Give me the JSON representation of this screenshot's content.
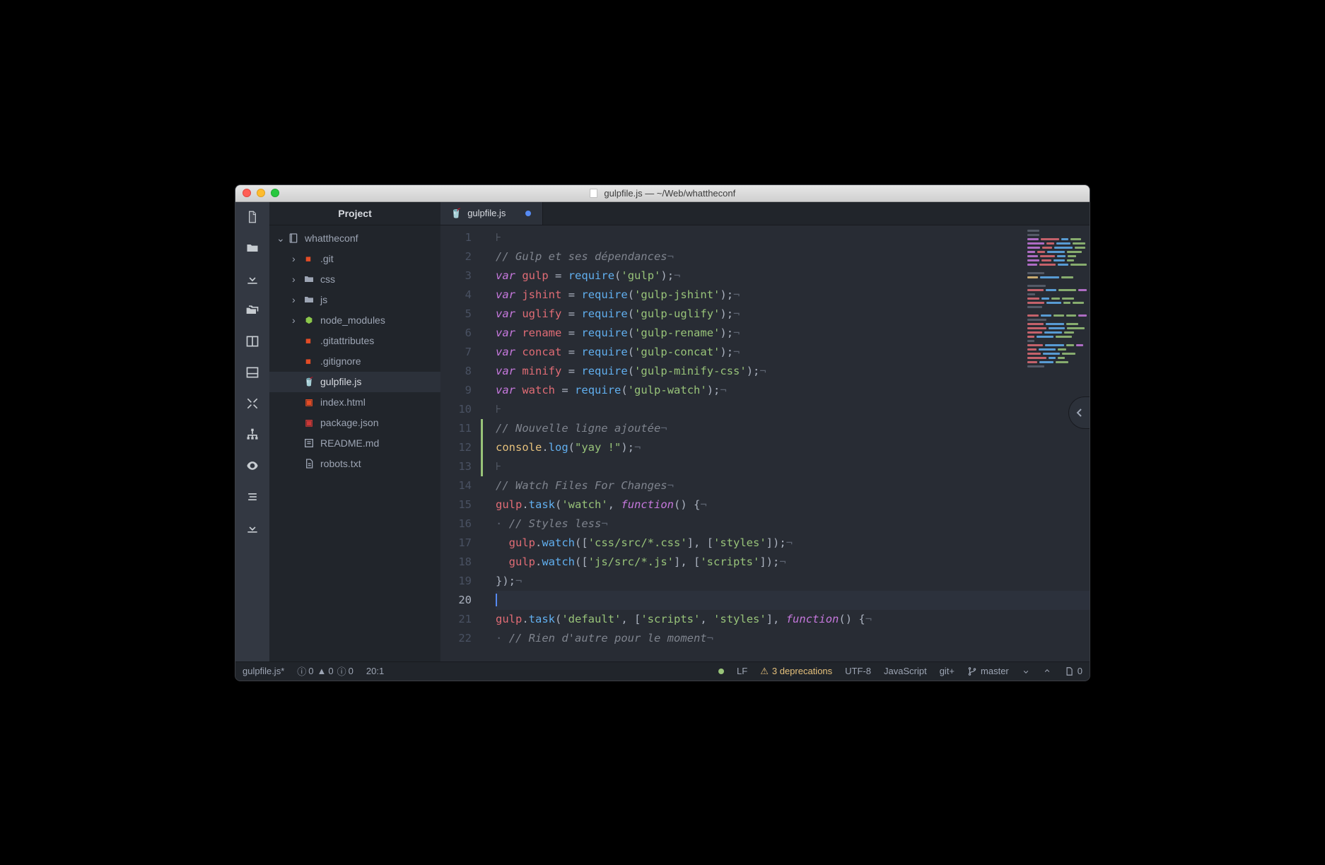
{
  "window": {
    "title": "gulpfile.js — ~/Web/whattheconf"
  },
  "sidebar": {
    "header": "Project",
    "tree": [
      {
        "depth": 0,
        "chevron": "⌄",
        "icon": "repo",
        "label": "whattheconf"
      },
      {
        "depth": 1,
        "chevron": "›",
        "icon": "git",
        "label": ".git"
      },
      {
        "depth": 1,
        "chevron": "›",
        "icon": "folder",
        "label": "css"
      },
      {
        "depth": 1,
        "chevron": "›",
        "icon": "folder",
        "label": "js"
      },
      {
        "depth": 1,
        "chevron": "›",
        "icon": "node",
        "label": "node_modules"
      },
      {
        "depth": 1,
        "chevron": "",
        "icon": "git",
        "label": ".gitattributes"
      },
      {
        "depth": 1,
        "chevron": "",
        "icon": "git",
        "label": ".gitignore"
      },
      {
        "depth": 1,
        "chevron": "",
        "icon": "gulp",
        "label": "gulpfile.js",
        "selected": true
      },
      {
        "depth": 1,
        "chevron": "",
        "icon": "html",
        "label": "index.html"
      },
      {
        "depth": 1,
        "chevron": "",
        "icon": "npm",
        "label": "package.json"
      },
      {
        "depth": 1,
        "chevron": "",
        "icon": "md",
        "label": "README.md"
      },
      {
        "depth": 1,
        "chevron": "",
        "icon": "txt",
        "label": "robots.txt"
      }
    ]
  },
  "tab": {
    "icon": "gulp",
    "label": "gulpfile.js",
    "modified": true
  },
  "editor": {
    "current_line": 20,
    "git_added_ranges": [
      [
        11,
        13
      ]
    ],
    "lines": [
      {
        "n": 1,
        "html": "<span class='c-inv'>⊦</span>"
      },
      {
        "n": 2,
        "html": "<span class='c-cmt'>// Gulp et ses dépendances</span><span class='c-inv'>¬</span>"
      },
      {
        "n": 3,
        "html": "<span class='c-kw'>var</span> <span class='c-var'>gulp</span> <span class='c-op'>=</span> <span class='c-fn'>require</span><span class='c-punc'>(</span><span class='c-str'>'gulp'</span><span class='c-punc'>);</span><span class='c-inv'>¬</span>"
      },
      {
        "n": 4,
        "html": "<span class='c-kw'>var</span> <span class='c-var'>jshint</span> <span class='c-op'>=</span> <span class='c-fn'>require</span><span class='c-punc'>(</span><span class='c-str'>'gulp-jshint'</span><span class='c-punc'>);</span><span class='c-inv'>¬</span>"
      },
      {
        "n": 5,
        "html": "<span class='c-kw'>var</span> <span class='c-var'>uglify</span> <span class='c-op'>=</span> <span class='c-fn'>require</span><span class='c-punc'>(</span><span class='c-str'>'gulp-uglify'</span><span class='c-punc'>);</span><span class='c-inv'>¬</span>"
      },
      {
        "n": 6,
        "html": "<span class='c-kw'>var</span> <span class='c-var'>rename</span> <span class='c-op'>=</span> <span class='c-fn'>require</span><span class='c-punc'>(</span><span class='c-str'>'gulp-rename'</span><span class='c-punc'>);</span><span class='c-inv'>¬</span>"
      },
      {
        "n": 7,
        "html": "<span class='c-kw'>var</span> <span class='c-var'>concat</span> <span class='c-op'>=</span> <span class='c-fn'>require</span><span class='c-punc'>(</span><span class='c-str'>'gulp-concat'</span><span class='c-punc'>);</span><span class='c-inv'>¬</span>"
      },
      {
        "n": 8,
        "html": "<span class='c-kw'>var</span> <span class='c-var'>minify</span> <span class='c-op'>=</span> <span class='c-fn'>require</span><span class='c-punc'>(</span><span class='c-str'>'gulp-minify-css'</span><span class='c-punc'>);</span><span class='c-inv'>¬</span>"
      },
      {
        "n": 9,
        "html": "<span class='c-kw'>var</span> <span class='c-var'>watch</span> <span class='c-op'>=</span> <span class='c-fn'>require</span><span class='c-punc'>(</span><span class='c-str'>'gulp-watch'</span><span class='c-punc'>);</span><span class='c-inv'>¬</span>"
      },
      {
        "n": 10,
        "html": "<span class='c-inv'>⊦</span>"
      },
      {
        "n": 11,
        "html": "<span class='c-cmt'>// Nouvelle ligne ajoutée</span><span class='c-inv'>¬</span>"
      },
      {
        "n": 12,
        "html": "<span class='c-obj'>console</span><span class='c-punc'>.</span><span class='c-fn'>log</span><span class='c-punc'>(</span><span class='c-str'>\"yay !\"</span><span class='c-punc'>);</span><span class='c-inv'>¬</span>"
      },
      {
        "n": 13,
        "html": "<span class='c-inv'>⊦</span>"
      },
      {
        "n": 14,
        "html": "<span class='c-cmt'>// Watch Files For Changes</span><span class='c-inv'>¬</span>"
      },
      {
        "n": 15,
        "html": "<span class='c-var'>gulp</span><span class='c-punc'>.</span><span class='c-fn'>task</span><span class='c-punc'>(</span><span class='c-str'>'watch'</span><span class='c-punc'>,</span> <span class='c-kw'>function</span><span class='c-punc'>() {</span><span class='c-inv'>¬</span>"
      },
      {
        "n": 16,
        "html": "<span class='c-inv'>·</span> <span class='c-cmt'>// Styles less</span><span class='c-inv'>¬</span>"
      },
      {
        "n": 17,
        "html": "  <span class='c-var'>gulp</span><span class='c-punc'>.</span><span class='c-fn'>watch</span><span class='c-punc'>([</span><span class='c-str'>'css/src/*.css'</span><span class='c-punc'>], [</span><span class='c-str'>'styles'</span><span class='c-punc'>]);</span><span class='c-inv'>¬</span>"
      },
      {
        "n": 18,
        "html": "  <span class='c-var'>gulp</span><span class='c-punc'>.</span><span class='c-fn'>watch</span><span class='c-punc'>([</span><span class='c-str'>'js/src/*.js'</span><span class='c-punc'>], [</span><span class='c-str'>'scripts'</span><span class='c-punc'>]);</span><span class='c-inv'>¬</span>"
      },
      {
        "n": 19,
        "html": "<span class='c-punc'>});</span><span class='c-inv'>¬</span>"
      },
      {
        "n": 20,
        "html": "<span class='c-inv' style='border-left:2px solid #568af2;'>&nbsp;</span>"
      },
      {
        "n": 21,
        "html": "<span class='c-var'>gulp</span><span class='c-punc'>.</span><span class='c-fn'>task</span><span class='c-punc'>(</span><span class='c-str'>'default'</span><span class='c-punc'>, [</span><span class='c-str'>'scripts'</span><span class='c-punc'>,</span> <span class='c-str'>'styles'</span><span class='c-punc'>],</span> <span class='c-kw'>function</span><span class='c-punc'>() {</span><span class='c-inv'>¬</span>"
      },
      {
        "n": 22,
        "html": "<span class='c-inv'>·</span> <span class='c-cmt'>// Rien d'autre pour le moment</span><span class='c-inv'>¬</span>"
      }
    ]
  },
  "status": {
    "filename": "gulpfile.js*",
    "diag_errors": "0",
    "diag_warnings": "0",
    "diag_info": "0",
    "cursor": "20:1",
    "line_ending": "LF",
    "deprecations": "3 deprecations",
    "encoding": "UTF-8",
    "language": "JavaScript",
    "git_label": "git+",
    "branch": "master",
    "file_count": "0"
  }
}
